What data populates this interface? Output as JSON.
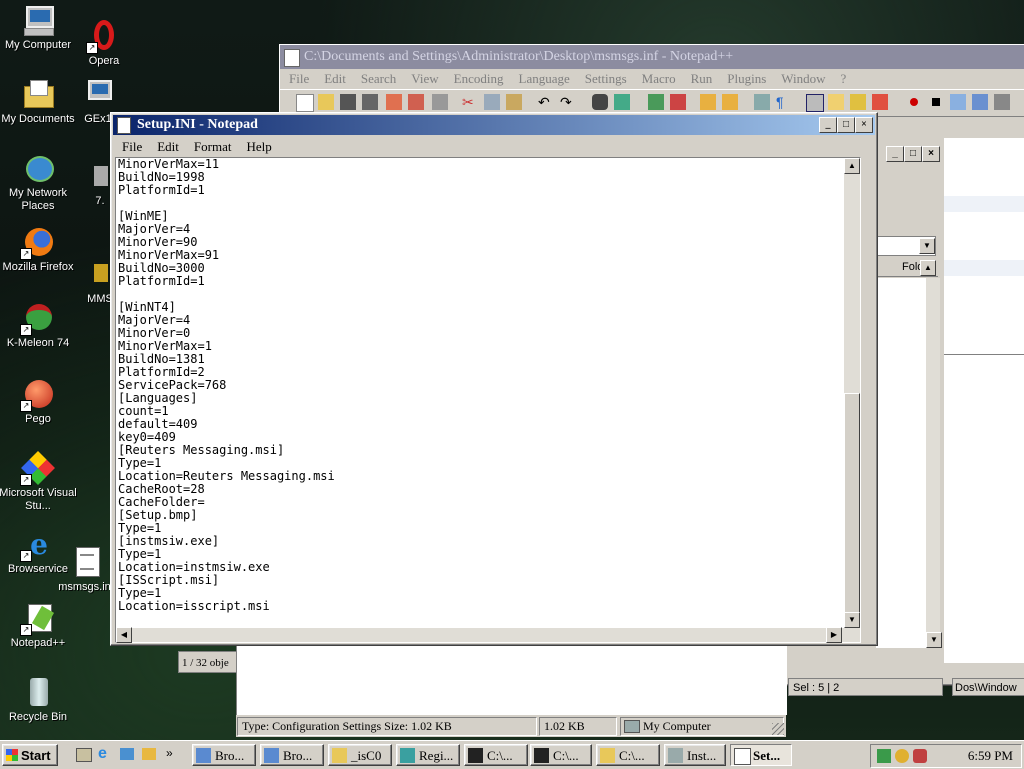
{
  "desktop": {
    "icons": [
      {
        "label": "My Computer"
      },
      {
        "label": "Opera"
      },
      {
        "label": "My Documents"
      },
      {
        "label": "GEx1"
      },
      {
        "label": "My Network Places"
      },
      {
        "label": "7."
      },
      {
        "label": "Mozilla Firefox"
      },
      {
        "label": "MMS"
      },
      {
        "label": "K-Meleon 74"
      },
      {
        "label": "Pego"
      },
      {
        "label": "Microsoft Visual Stu..."
      },
      {
        "label": "Browservice"
      },
      {
        "label": "msmsgs.inf"
      },
      {
        "label": "Notepad++"
      },
      {
        "label": "Recycle Bin"
      }
    ]
  },
  "notepadpp": {
    "title": "C:\\Documents and Settings\\Administrator\\Desktop\\msmsgs.inf - Notepad++",
    "menu": [
      "File",
      "Edit",
      "Search",
      "View",
      "Encoding",
      "Language",
      "Settings",
      "Macro",
      "Run",
      "Plugins",
      "Window",
      "?"
    ],
    "status_sel": "Sel : 5 | 2",
    "status_eol": "Dos\\Window"
  },
  "explorer": {
    "folder_col": "Folde",
    "object_count": "1 / 32 obje",
    "status_type": "Type: Configuration Settings Size: 1.02 KB",
    "status_size": "1.02 KB",
    "status_location": "My Computer"
  },
  "notepad": {
    "title": "Setup.INI - Notepad",
    "menu": [
      "File",
      "Edit",
      "Format",
      "Help"
    ],
    "content": "MinorVerMax=11\nBuildNo=1998\nPlatformId=1\n\n[WinME]\nMajorVer=4\nMinorVer=90\nMinorVerMax=91\nBuildNo=3000\nPlatformId=1\n\n[WinNT4]\nMajorVer=4\nMinorVer=0\nMinorVerMax=1\nBuildNo=1381\nPlatformId=2\nServicePack=768\n[Languages]\ncount=1\ndefault=409\nkey0=409\n[Reuters Messaging.msi]\nType=1\nLocation=Reuters Messaging.msi\nCacheRoot=28\nCacheFolder=\n[Setup.bmp]\nType=1\n[instmsiw.exe]\nType=1\nLocation=instmsiw.exe\n[ISScript.msi]\nType=1\nLocation=isscript.msi"
  },
  "taskbar": {
    "start": "Start",
    "buttons": [
      "Bro...",
      "Bro...",
      "_isC0",
      "Regi...",
      "C:\\...",
      "C:\\...",
      "C:\\...",
      "Inst...",
      "Set..."
    ],
    "clock": "6:59 PM"
  },
  "colors": {
    "win_face": "#d4d0c8",
    "active_title": "#0a246a",
    "inactive_title": "#8c8ca0"
  }
}
